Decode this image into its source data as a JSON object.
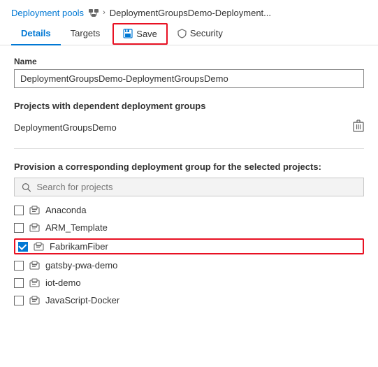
{
  "breadcrumb": {
    "link_label": "Deployment pools",
    "separator": "›",
    "current": "DeploymentGroupsDemo-Deployment..."
  },
  "tabs": [
    {
      "id": "details",
      "label": "Details",
      "active": true
    },
    {
      "id": "targets",
      "label": "Targets",
      "active": false
    },
    {
      "id": "save",
      "label": "Save",
      "is_button": true
    },
    {
      "id": "security",
      "label": "Security",
      "active": false
    }
  ],
  "save_button": {
    "label": "Save"
  },
  "security_tab": {
    "label": "Security"
  },
  "details_tab": {
    "label": "Details"
  },
  "targets_tab": {
    "label": "Targets"
  },
  "name_field": {
    "label": "Name",
    "value": "DeploymentGroupsDemo-DeploymentGroupsDemo"
  },
  "dependent_section": {
    "title": "Projects with dependent deployment groups",
    "project": "DeploymentGroupsDemo"
  },
  "provision_section": {
    "label": "Provision a corresponding deployment group for the selected projects:",
    "search_placeholder": "Search for projects",
    "projects": [
      {
        "id": "anaconda",
        "name": "Anaconda",
        "checked": false
      },
      {
        "id": "arm-template",
        "name": "ARM_Template",
        "checked": false
      },
      {
        "id": "fabrikamfiber",
        "name": "FabrikamFiber",
        "checked": true
      },
      {
        "id": "gatsby-pwa-demo",
        "name": "gatsby-pwa-demo",
        "checked": false
      },
      {
        "id": "iot-demo",
        "name": "iot-demo",
        "checked": false
      },
      {
        "id": "javascript-docker",
        "name": "JavaScript-Docker",
        "checked": false
      }
    ]
  }
}
